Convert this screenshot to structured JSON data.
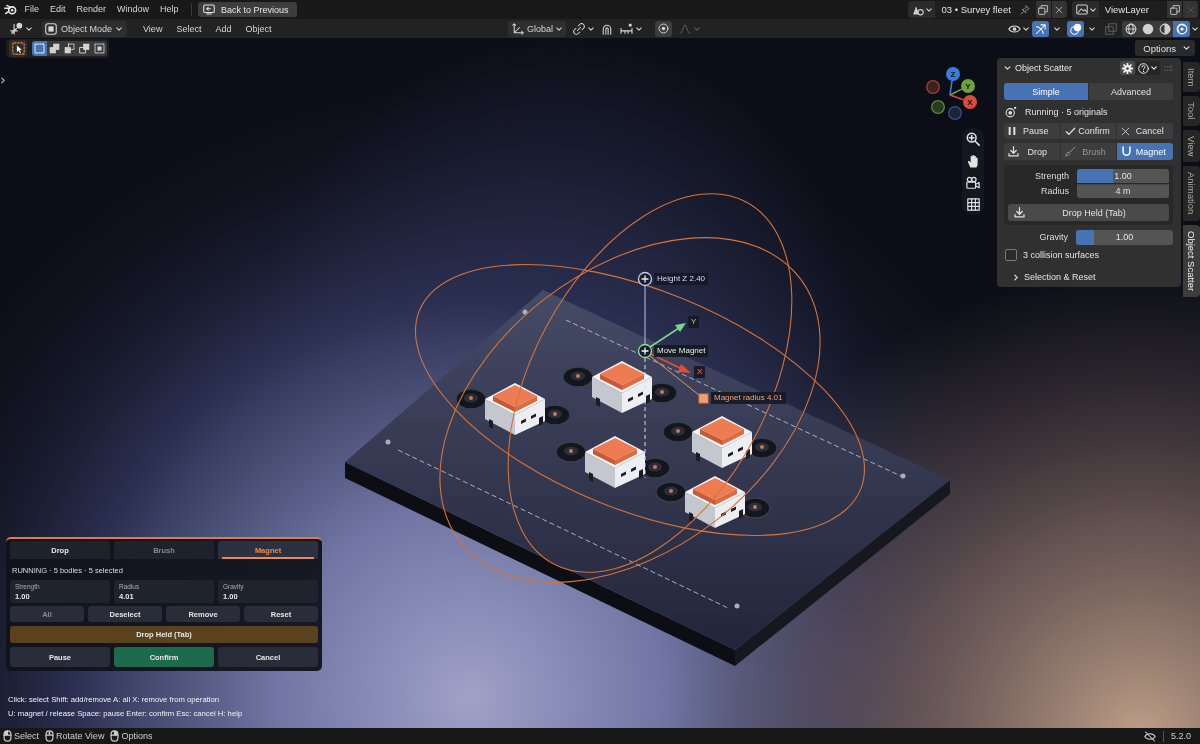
{
  "topbar": {
    "menus": [
      "File",
      "Edit",
      "Render",
      "Window",
      "Help"
    ],
    "back_button": "Back to Previous",
    "scene": "03 • Survey fleet",
    "view_layer": "ViewLayer"
  },
  "header": {
    "mode": "Object Mode",
    "menus": [
      "View",
      "Select",
      "Add",
      "Object"
    ],
    "orientation": "Global",
    "toggles": [
      {
        "kind": "gizmos",
        "on": true
      },
      {
        "kind": "overlays",
        "on": true
      },
      {
        "kind": "xray",
        "on": false
      }
    ],
    "shading": [
      {
        "kind": "wireframe",
        "selected": false
      },
      {
        "kind": "solid",
        "selected": false
      },
      {
        "kind": "material",
        "selected": false
      },
      {
        "kind": "rendered",
        "selected": true
      }
    ]
  },
  "tool_settings": {
    "select_modes": [
      {
        "kind": "set",
        "selected": true
      },
      {
        "kind": "extend",
        "selected": false
      },
      {
        "kind": "subtract",
        "selected": false
      },
      {
        "kind": "invert",
        "selected": false
      },
      {
        "kind": "intersect",
        "selected": false
      }
    ],
    "options_button": "Options"
  },
  "viewport": {
    "nav_gizmo": [
      {
        "kind": "z",
        "label": "Z"
      },
      {
        "kind": "y",
        "label": "Y"
      },
      {
        "kind": "x",
        "label": "X"
      }
    ],
    "manipulator": {
      "height_label": "Height Z 2.40",
      "move_label": "Move Magnet",
      "y_label": "Y",
      "x_label": "X",
      "radius_label": "Magnet radius 4.01"
    }
  },
  "sidebar": {
    "tabs": [
      {
        "label": "Item",
        "selected": false
      },
      {
        "label": "Tool",
        "selected": false
      },
      {
        "label": "View",
        "selected": false
      },
      {
        "label": "Animation",
        "selected": false
      },
      {
        "label": "Object Scatter",
        "selected": true
      }
    ],
    "panel": {
      "title": "Object Scatter",
      "expanded": true,
      "mode_tabs": [
        {
          "label": "Simple",
          "selected": true
        },
        {
          "label": "Advanced",
          "selected": false
        }
      ],
      "status": "Running · 5 originals",
      "actions": [
        {
          "kind": "pause",
          "label": "Pause"
        },
        {
          "kind": "confirm",
          "label": "Confirm"
        },
        {
          "kind": "cancel",
          "label": "Cancel"
        }
      ],
      "tools": [
        {
          "kind": "drop",
          "label": "Drop",
          "selected": false,
          "disabled": false
        },
        {
          "kind": "brush",
          "label": "Brush",
          "selected": false,
          "disabled": true
        },
        {
          "kind": "magnet",
          "label": "Magnet",
          "selected": true,
          "disabled": false
        }
      ],
      "fields": [
        {
          "kind": "slider",
          "label": "Strength",
          "value": "1.00",
          "level": 0.39
        },
        {
          "kind": "number",
          "label": "Radius",
          "value": "4 m"
        }
      ],
      "drop_button": "Drop Held (Tab)",
      "gravity": {
        "label": "Gravity",
        "value": "1.00",
        "level": 0.19
      },
      "collision": {
        "label": "3 collision surfaces",
        "checked": false
      },
      "subpanel": {
        "label": "Selection & Reset",
        "expanded": false
      }
    }
  },
  "operator_panel": {
    "tabs": [
      {
        "label": "Drop",
        "selected": false,
        "disabled": false
      },
      {
        "label": "Brush",
        "selected": false,
        "disabled": true
      },
      {
        "label": "Magnet",
        "selected": true,
        "disabled": false
      }
    ],
    "status": "RUNNING · 5 bodies · 5 selected",
    "stats": [
      {
        "label": "Strength",
        "value": "1.00"
      },
      {
        "label": "Radius",
        "value": "4.01"
      },
      {
        "label": "Gravity",
        "value": "1.00"
      }
    ],
    "selection_buttons": [
      {
        "label": "All",
        "disabled": true
      },
      {
        "label": "Deselect",
        "disabled": false
      },
      {
        "label": "Remove",
        "disabled": false
      },
      {
        "label": "Reset",
        "disabled": false
      }
    ],
    "drop_button": "Drop Held (Tab)",
    "actions": [
      {
        "kind": "pause",
        "label": "Pause"
      },
      {
        "kind": "confirm",
        "label": "Confirm"
      },
      {
        "kind": "cancel",
        "label": "Cancel"
      }
    ]
  },
  "hints": [
    "Click: select Shift: add/remove A: all X: remove from operation",
    "U: magnet / release Space: pause Enter: confirm Esc: cancel H: help"
  ],
  "status_bar": {
    "items": [
      {
        "kind": "left",
        "label": "Select"
      },
      {
        "kind": "middle",
        "label": "Rotate View"
      },
      {
        "kind": "right",
        "label": "Options"
      }
    ],
    "version": "5.2.0"
  }
}
